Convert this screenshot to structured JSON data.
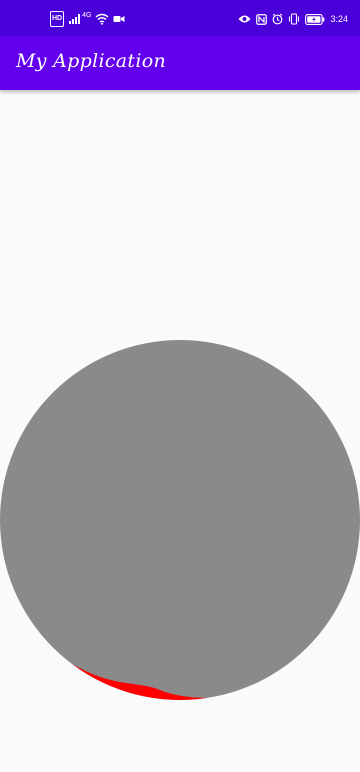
{
  "status_bar": {
    "network_badge": "HD",
    "signal_label": "4G",
    "time": "3:24",
    "icons": [
      "hd-icon",
      "signal-icon",
      "wifi-icon",
      "video-icon",
      "eye-icon",
      "nfc-icon",
      "alarm-icon",
      "vibrate-icon",
      "battery-icon"
    ]
  },
  "app_bar": {
    "title": "My Application"
  },
  "wave_view": {
    "circle_color": "#8a8a8a",
    "wave_color": "#ff0000",
    "progress": 0.08
  },
  "colors": {
    "status_bar": "#4a00d9",
    "app_bar": "#6200ee",
    "background": "#fafafa"
  }
}
